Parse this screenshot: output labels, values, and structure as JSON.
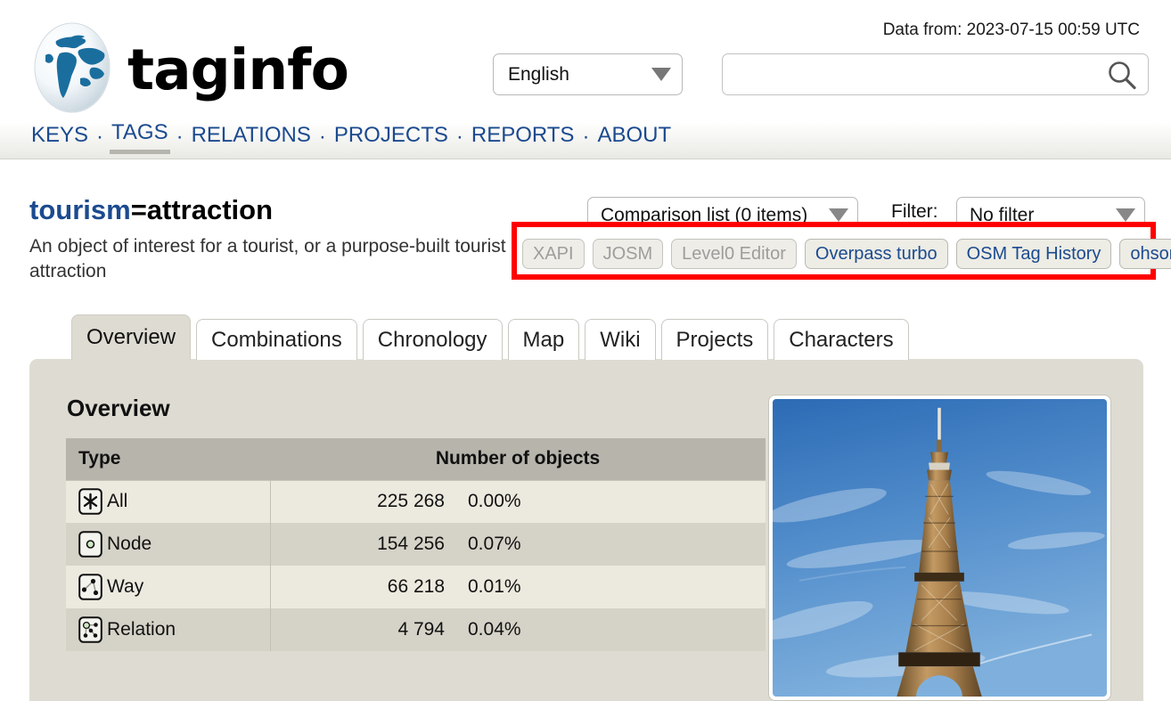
{
  "header": {
    "brand_tag": "tag",
    "brand_info": "info",
    "data_from": "Data from: 2023-07-15 00:59 UTC",
    "language_value": "English",
    "search_placeholder": "",
    "search_value": ""
  },
  "nav": {
    "separator": "·",
    "items": [
      {
        "label": "KEYS",
        "active": false
      },
      {
        "label": "TAGS",
        "active": true
      },
      {
        "label": "RELATIONS",
        "active": false
      },
      {
        "label": "PROJECTS",
        "active": false
      },
      {
        "label": "REPORTS",
        "active": false
      },
      {
        "label": "ABOUT",
        "active": false
      }
    ]
  },
  "tag": {
    "key": "tourism",
    "equals": "=",
    "value": "attraction",
    "description": "An object of interest for a tourist, or a purpose-built tourist attraction"
  },
  "controls": {
    "comparison_list": "Comparison list (0 items)",
    "filter_label": "Filter:",
    "filter_value": "No filter"
  },
  "tools": {
    "highlighted": true,
    "highlight_color": "#ff0000",
    "buttons": [
      {
        "label": "XAPI",
        "disabled": true
      },
      {
        "label": "JOSM",
        "disabled": true
      },
      {
        "label": "Level0 Editor",
        "disabled": true
      },
      {
        "label": "Overpass turbo",
        "disabled": false
      },
      {
        "label": "OSM Tag History",
        "disabled": false
      },
      {
        "label": "ohsome",
        "disabled": false
      }
    ]
  },
  "tabs": [
    {
      "label": "Overview",
      "active": true
    },
    {
      "label": "Combinations",
      "active": false
    },
    {
      "label": "Chronology",
      "active": false
    },
    {
      "label": "Map",
      "active": false
    },
    {
      "label": "Wiki",
      "active": false
    },
    {
      "label": "Projects",
      "active": false
    },
    {
      "label": "Characters",
      "active": false
    }
  ],
  "overview": {
    "heading": "Overview",
    "table": {
      "columns": [
        "Type",
        "Number of objects"
      ],
      "rows": [
        {
          "icon": "all-icon",
          "type": "All",
          "count": "225 268",
          "percent": "0.00%"
        },
        {
          "icon": "node-icon",
          "type": "Node",
          "count": "154 256",
          "percent": "0.07%"
        },
        {
          "icon": "way-icon",
          "type": "Way",
          "count": "66 218",
          "percent": "0.01%"
        },
        {
          "icon": "relation-icon",
          "type": "Relation",
          "count": "4 794",
          "percent": "0.04%"
        }
      ]
    },
    "photo_alt": "Eiffel Tower against blue sky"
  },
  "colors": {
    "link_blue": "#1b4a8f",
    "panel_bg": "#dedcd2",
    "table_header": "#b6b4ab",
    "row_odd": "#eceadf",
    "row_even": "#d5d3c8",
    "highlight_red": "#ff0000"
  }
}
